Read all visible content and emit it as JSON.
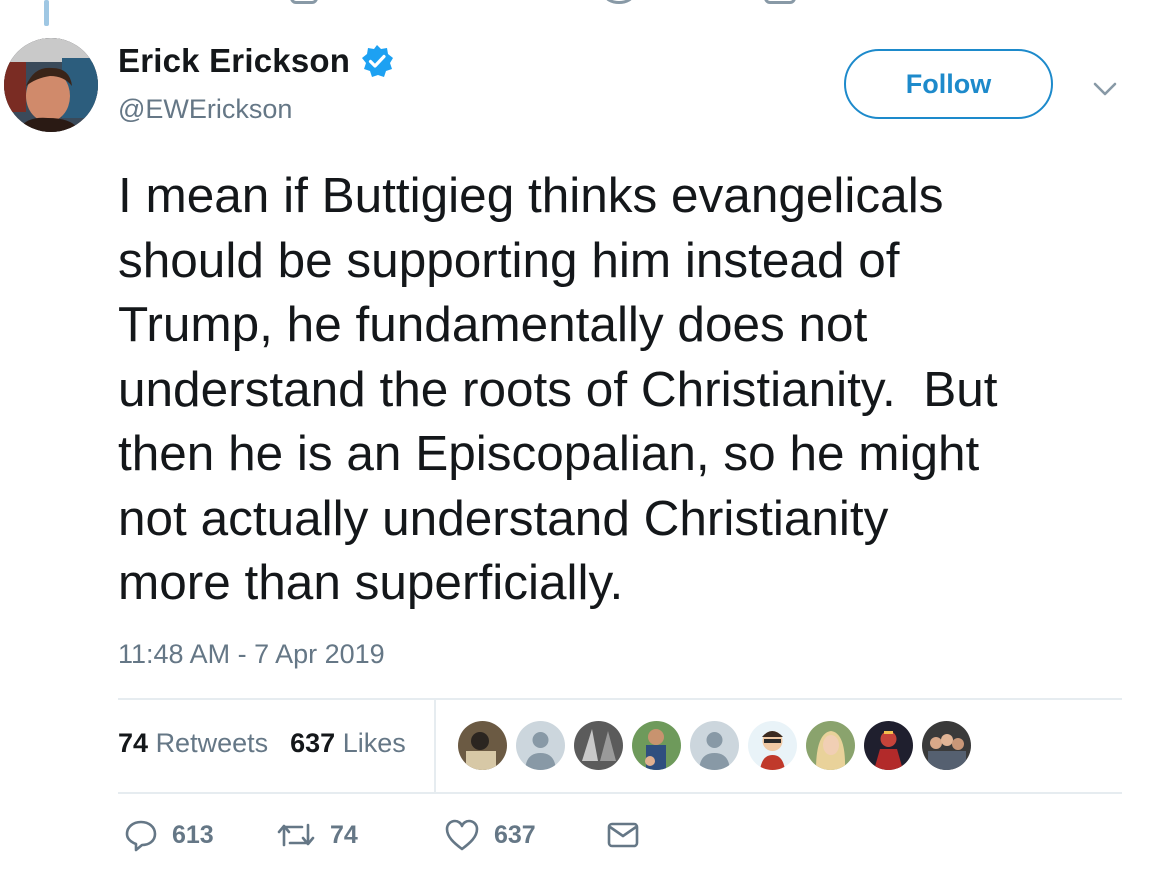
{
  "author": {
    "name": "Erick Erickson",
    "handle": "@EWErickson",
    "verified": true
  },
  "follow_label": "Follow",
  "tweet": {
    "text": "I mean if Buttigieg thinks evangelicals\nshould be supporting him instead of\nTrump, he fundamentally does not\nunderstand the roots of Christianity.  But\nthen he is an Episcopalian, so he might\nnot actually understand Christianity\nmore than superficially.",
    "timestamp": "11:48 AM - 7 Apr 2019"
  },
  "stats": {
    "retweets_count": "74",
    "retweets_label": "Retweets",
    "likes_count": "637",
    "likes_label": "Likes"
  },
  "actions": {
    "replies": "613",
    "retweets": "74",
    "likes": "637"
  },
  "colors": {
    "accent": "#1d8acb",
    "verified": "#1da1f2",
    "muted": "#657786",
    "text": "#14171a",
    "divider": "#e6ecf0"
  },
  "icons": [
    "verified-badge-icon",
    "chevron-down-icon",
    "reply-icon",
    "retweet-icon",
    "heart-icon",
    "message-icon"
  ]
}
